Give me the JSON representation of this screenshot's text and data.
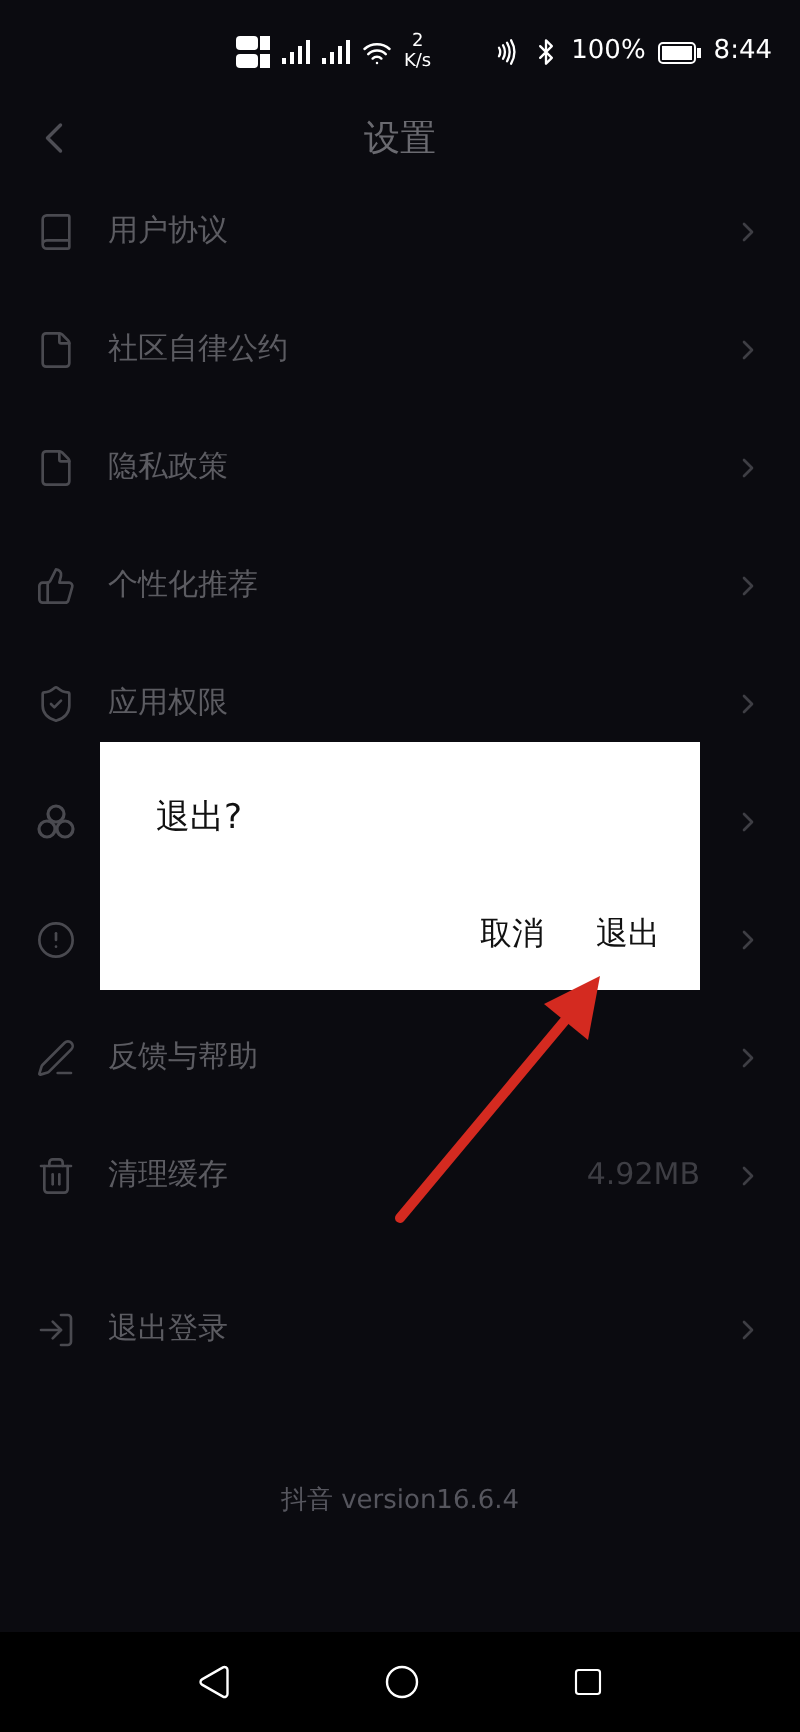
{
  "status_bar": {
    "speed_value": "2",
    "speed_unit": "K/s",
    "battery": "100%",
    "time": "8:44"
  },
  "header": {
    "title": "设置"
  },
  "rows": [
    {
      "kind": "book",
      "label": "用户协议"
    },
    {
      "kind": "file",
      "label": "社区自律公约"
    },
    {
      "kind": "file",
      "label": "隐私政策"
    },
    {
      "kind": "thumb",
      "label": "个性化推荐"
    },
    {
      "kind": "shield",
      "label": "应用权限"
    },
    {
      "kind": "circles"
    },
    {
      "kind": "alert"
    },
    {
      "kind": "pen",
      "label": "反馈与帮助"
    },
    {
      "kind": "trash",
      "label": "清理缓存",
      "value": "4.92MB"
    }
  ],
  "logout": {
    "label": "退出登录"
  },
  "version": "抖音 version16.6.4",
  "dialog": {
    "title": "退出?",
    "buttons": [
      "取消",
      "退出"
    ]
  }
}
